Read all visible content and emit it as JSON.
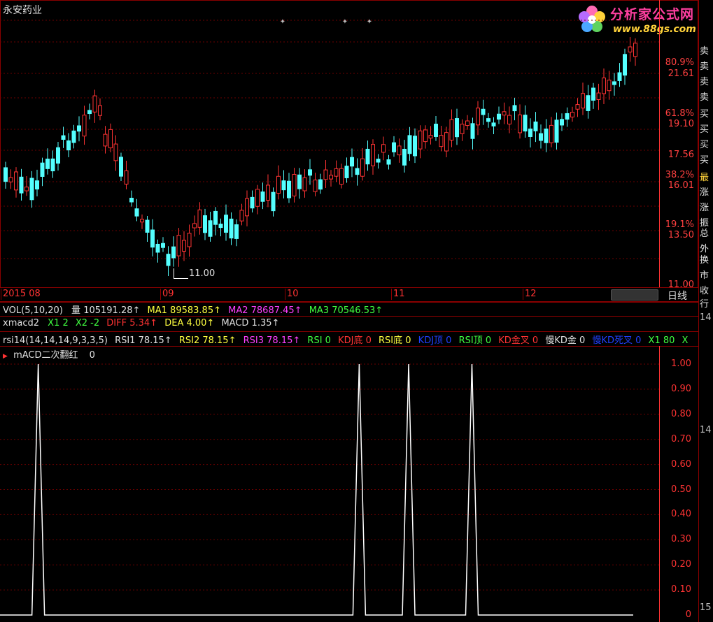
{
  "stock_title": "永安药业",
  "logo": {
    "name": "分析家公式网",
    "url": "www.88gs.com"
  },
  "main_chart": {
    "price_labels": [
      {
        "text": "80.9%",
        "color": "#ff4040"
      },
      {
        "text": "21.61",
        "color": "#ff4040"
      },
      {
        "text": "61.8%",
        "color": "#ff4040"
      },
      {
        "text": "19.10",
        "color": "#ff4040"
      },
      {
        "text": "17.56",
        "color": "#ff4040"
      },
      {
        "text": "38.2%",
        "color": "#ff4040"
      },
      {
        "text": "16.01",
        "color": "#ff4040"
      },
      {
        "text": "19.1%",
        "color": "#ff4040"
      },
      {
        "text": "13.50",
        "color": "#ff4040"
      },
      {
        "text": "11.00",
        "color": "#ff4040"
      }
    ],
    "low_marker": "11.00",
    "period_button": "日线",
    "timeline": [
      "2015 08",
      "09",
      "10",
      "11",
      "12"
    ]
  },
  "side_panel": [
    "卖",
    "卖",
    "卖",
    "卖",
    "买",
    "买",
    "买",
    "买",
    "最",
    "涨",
    "涨",
    "振",
    "总",
    "外",
    "换",
    "市",
    "收",
    "行"
  ],
  "side_numbers": [
    "14",
    "14",
    "15"
  ],
  "vol_row": {
    "name": "VOL(5,10,20)",
    "vol_label": "量",
    "vol_value": "105191.28↑",
    "ma1": "MA1 89583.85↑",
    "ma2": "MA2 78687.45↑",
    "ma3": "MA3 70546.53↑"
  },
  "macd_row": {
    "name": "xmacd2",
    "x1": "X1 2",
    "x2": "X2 -2",
    "diff": "DIFF 5.34↑",
    "dea": "DEA 4.00↑",
    "macd": "MACD 1.35↑"
  },
  "rsi_row": {
    "name": "rsi14(14,14,14,9,3,3,5)",
    "rsi1": "RSI1 78.15↑",
    "rsi2": "RSI2 78.15↑",
    "rsi3": "RSI3 78.15↑",
    "rsi": "RSI 0",
    "kdj_bottom": "KDJ底 0",
    "rsi_bottom": "RSI底 0",
    "kdj_top": "KDJ顶 0",
    "rsi_top": "RSI顶 0",
    "kd_gold": "KD金叉 0",
    "slow_kd_gold": "慢KD金 0",
    "slow_kd_dead": "慢KD死叉 0",
    "x1": "X1 80",
    "x": "X"
  },
  "indicator": {
    "name": "mACD二次翻红",
    "value": "0",
    "axis": [
      "1.00",
      "0.90",
      "0.80",
      "0.70",
      "0.60",
      "0.50",
      "0.40",
      "0.30",
      "0.20",
      "0.10",
      "0"
    ],
    "spikes_at_fraction": [
      0.058,
      0.545,
      0.62,
      0.716
    ]
  },
  "colors": {
    "up": "#ff3333",
    "down": "#54ffff",
    "grid": "#8b0000",
    "axis": "#ff3333"
  }
}
